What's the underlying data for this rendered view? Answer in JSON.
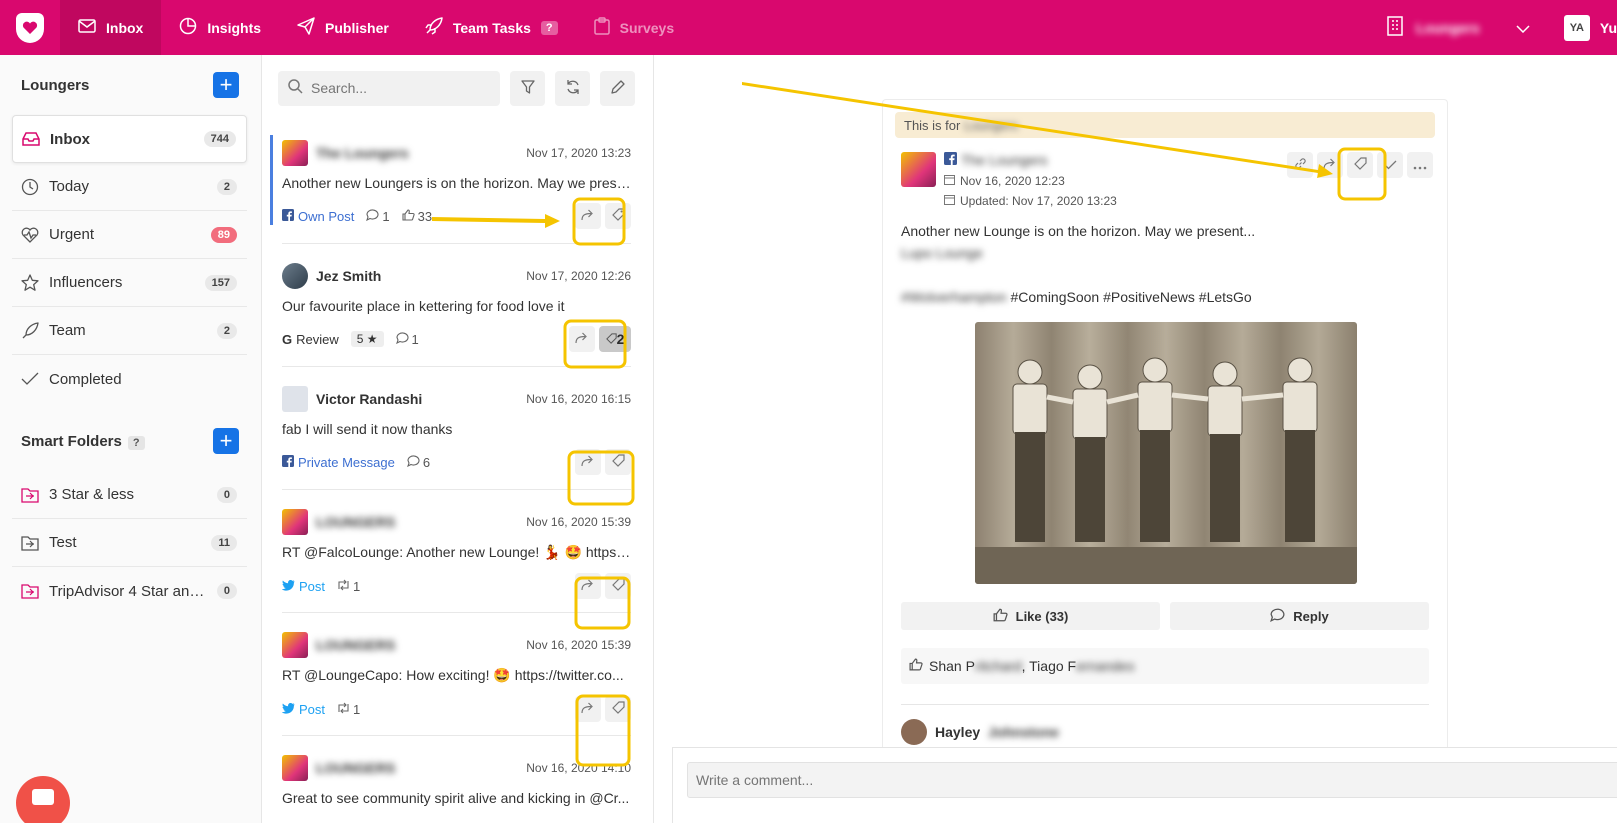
{
  "topnav": {
    "items": [
      {
        "label": "Inbox",
        "icon": "mail-icon"
      },
      {
        "label": "Insights",
        "icon": "pie-chart-icon"
      },
      {
        "label": "Publisher",
        "icon": "paper-plane-icon"
      },
      {
        "label": "Team Tasks",
        "icon": "rocket-icon",
        "badge": "?"
      },
      {
        "label": "Surveys",
        "icon": "clipboard-icon"
      }
    ],
    "account_name": "Loungers",
    "avatar_initials": "YA",
    "user_initial": "Yu"
  },
  "sidebar": {
    "title": "Loungers",
    "items": [
      {
        "label": "Inbox",
        "count": "744",
        "icon": "inbox-icon"
      },
      {
        "label": "Today",
        "count": "2",
        "icon": "clock-icon"
      },
      {
        "label": "Urgent",
        "count": "89",
        "icon": "heartbeat-icon"
      },
      {
        "label": "Influencers",
        "count": "157",
        "icon": "star-icon"
      },
      {
        "label": "Team",
        "count": "2",
        "icon": "rocket-icon"
      },
      {
        "label": "Completed",
        "count": "",
        "icon": "check-icon"
      }
    ],
    "smart_title": "Smart Folders",
    "smart_badge": "?",
    "smart_items": [
      {
        "label": "3 Star & less",
        "count": "0"
      },
      {
        "label": "Test",
        "count": "11"
      },
      {
        "label": "TripAdvisor 4 Star and ...",
        "count": "0"
      }
    ]
  },
  "list": {
    "search_placeholder": "Search...",
    "messages": [
      {
        "author": "The Loungers",
        "date": "Nov 17, 2020 13:23",
        "text": "Another new Loungers is on the horizon. May we present...",
        "source": "Own Post",
        "comments": "1",
        "likes": "33"
      },
      {
        "author": "Jez Smith",
        "date": "Nov 17, 2020 12:26",
        "text": "Our favourite place in kettering for food love it",
        "source": "Review",
        "rating": "5 ★",
        "comments": "1",
        "tag_count": "2"
      },
      {
        "author": "Victor Randashi",
        "date": "Nov 16, 2020 16:15",
        "text": "fab I will send it now thanks",
        "source": "Private Message",
        "comments": "6"
      },
      {
        "author": "LOUNGERS",
        "date": "Nov 16, 2020 15:39",
        "text": "RT @FalcoLounge: Another new Lounge! 💃 🤩 https://...",
        "source": "Post",
        "retweets": "1"
      },
      {
        "author": "LOUNGERS",
        "date": "Nov 16, 2020 15:39",
        "text": "RT @LoungeCapo: How exciting! 🤩 https://twitter.co...",
        "source": "Post",
        "retweets": "1"
      },
      {
        "author": "LOUNGERS",
        "date": "Nov 16, 2020 14:10",
        "text": "Great to see community spirit alive and kicking in @Cr..."
      }
    ]
  },
  "detail": {
    "note_prefix": "This is for ",
    "note_name": "Loungers",
    "author": "The Loungers",
    "created": "Nov 16, 2020 12:23",
    "updated": "Updated: Nov 17, 2020 13:23",
    "body_line1": "Another new Lounge is on the horizon. May we present...",
    "body_line2": "Lupo Lounge",
    "hashtag_blur": "#Wolverhampton",
    "hashtags": " #ComingSoon #PositiveNews #LetsGo",
    "like_label": "Like (33)",
    "reply_label": "Reply",
    "likers_a": "Shan P",
    "likers_a_blur": "ritchard",
    "likers_b": ", Tiago F",
    "likers_b_blur": "ernandes",
    "commenter_first": "Hayley",
    "commenter_last": "Johnstone",
    "comment_placeholder": "Write a comment..."
  },
  "colors": {
    "brand": "#d9086e",
    "accent_blue": "#1673e6",
    "highlight": "#f5c400"
  }
}
